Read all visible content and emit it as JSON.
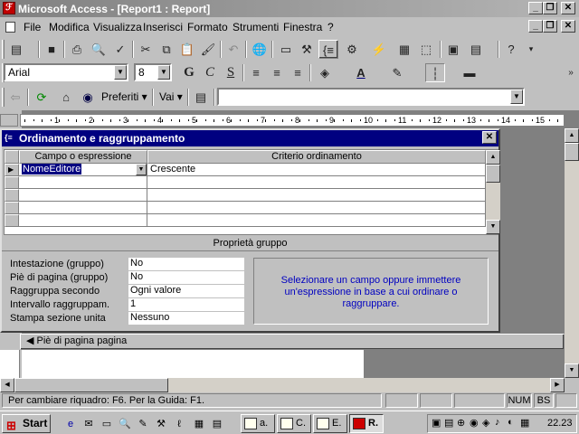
{
  "window": {
    "title": "Microsoft Access - [Report1 : Report]"
  },
  "menu": [
    "File",
    "Modifica",
    "Visualizza",
    "Inserisci",
    "Formato",
    "Strumenti",
    "Finestra",
    "?"
  ],
  "formatting": {
    "font": "Arial",
    "size": "8"
  },
  "web": {
    "favorites": "Preferiti",
    "goto": "Vai",
    "address": ""
  },
  "ruler": {
    "marks": [
      "1",
      "2",
      "3",
      "4",
      "5",
      "6",
      "7",
      "8",
      "9",
      "10",
      "11",
      "12",
      "13",
      "14",
      "15"
    ]
  },
  "dialog": {
    "title": "Ordinamento e raggruppamento",
    "col_field": "Campo o espressione",
    "col_order": "Criterio ordinamento",
    "rows": [
      {
        "field": "NomeEditore",
        "order": "Crescente"
      }
    ],
    "props_title": "Proprietà gruppo",
    "props": [
      {
        "label": "Intestazione (gruppo)",
        "value": "No"
      },
      {
        "label": "Piè di pagina (gruppo)",
        "value": "No"
      },
      {
        "label": "Raggruppa secondo",
        "value": "Ogni valore"
      },
      {
        "label": "Intervallo raggruppam.",
        "value": "1"
      },
      {
        "label": "Stampa sezione unita",
        "value": "Nessuno"
      }
    ],
    "hint": "Selezionare un campo oppure immettere un'espressione in base a cui ordinare o raggruppare."
  },
  "report": {
    "page_footer": "Piè di pagina pagina"
  },
  "statusbar": {
    "text": "Per cambiare riquadro: F6. Per la Guida: F1.",
    "num": "NUM",
    "bs": "BS"
  },
  "taskbar": {
    "start": "Start",
    "tasks": [
      "a.",
      "C.",
      "E.",
      "R."
    ],
    "clock": "22.23"
  }
}
